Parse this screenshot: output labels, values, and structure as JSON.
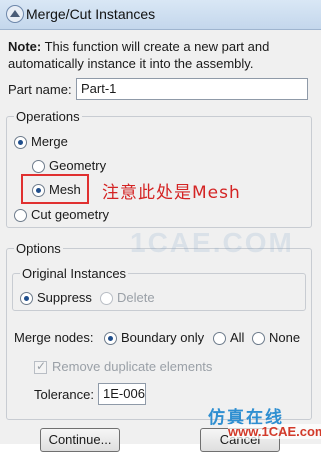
{
  "window": {
    "title": "Merge/Cut Instances"
  },
  "note": {
    "prefix": "Note:",
    "text": "This function will create a new part and automatically instance it into the assembly."
  },
  "part_name": {
    "label": "Part name:",
    "value": "Part-1"
  },
  "operations": {
    "title": "Operations",
    "merge_label": "Merge",
    "geometry_label": "Geometry",
    "mesh_label": "Mesh",
    "cut_geometry_label": "Cut geometry",
    "selected_operation": "Merge",
    "selected_merge_type": "Mesh"
  },
  "annotation": {
    "text": "注意此处是Mesh",
    "color": "#d42424"
  },
  "options": {
    "title": "Options",
    "original_instances": {
      "title": "Original Instances",
      "suppress_label": "Suppress",
      "delete_label": "Delete",
      "selected": "Suppress"
    },
    "merge_nodes": {
      "label": "Merge nodes:",
      "boundary_only_label": "Boundary only",
      "all_label": "All",
      "none_label": "None",
      "selected": "Boundary only"
    },
    "remove_duplicates": {
      "label": "Remove duplicate elements",
      "checked": true,
      "enabled": false
    },
    "tolerance": {
      "label": "Tolerance:",
      "value": "1E-006"
    }
  },
  "buttons": {
    "continue_label": "Continue...",
    "cancel_label": "Cancel"
  },
  "watermarks": {
    "center": "1CAE.COM",
    "brand_cn": "仿真在线",
    "url": "www.1CAE.com"
  }
}
